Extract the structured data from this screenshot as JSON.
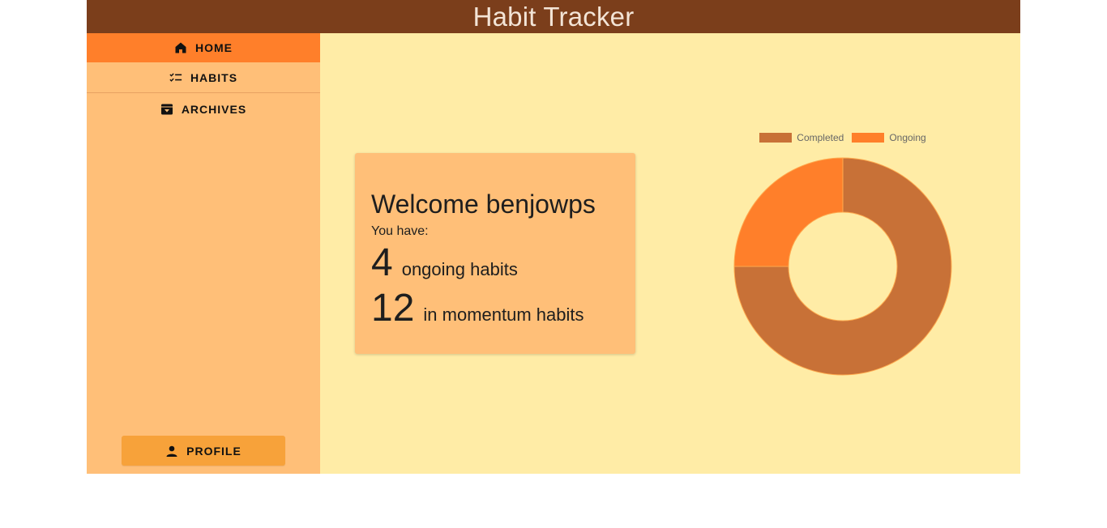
{
  "app": {
    "title": "Habit Tracker"
  },
  "sidebar": {
    "items": [
      {
        "label": "HOME",
        "icon": "home-icon",
        "active": true
      },
      {
        "label": "HABITS",
        "icon": "checklist-icon",
        "active": false
      },
      {
        "label": "ARCHIVES",
        "icon": "archive-icon",
        "active": false
      }
    ],
    "profile_label": "PROFILE"
  },
  "welcome_card": {
    "greeting": "Welcome benjowps",
    "intro": "You have:",
    "ongoing_count": "4",
    "ongoing_label": "ongoing habits",
    "momentum_count": "12",
    "momentum_label": "in momentum habits"
  },
  "chart_data": {
    "type": "pie",
    "style": "doughnut",
    "legend_position": "top",
    "labels": [
      "Completed",
      "Ongoing"
    ],
    "values": [
      12,
      4
    ],
    "colors": [
      "#c87137",
      "#ff7f2a"
    ]
  },
  "colors": {
    "header": "#7b3e1b",
    "sidebar": "#ffbf78",
    "active_item": "#ff7f2a",
    "main_bg": "#ffeca6",
    "profile_button": "#f7a23a"
  }
}
